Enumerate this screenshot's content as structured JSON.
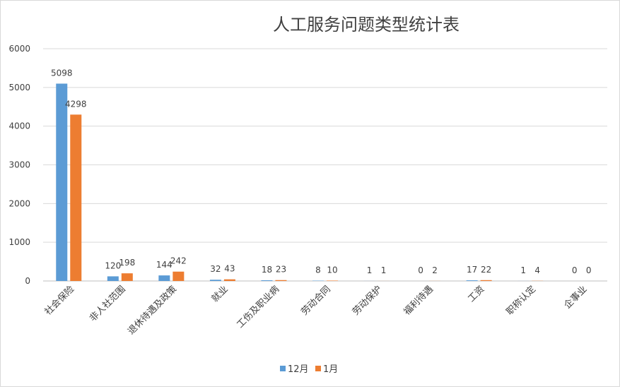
{
  "chart_data": {
    "type": "bar",
    "title": "人工服务问题类型统计表",
    "xlabel": "",
    "ylabel": "",
    "ylim": [
      0,
      6000
    ],
    "yticks": [
      0,
      1000,
      2000,
      3000,
      4000,
      5000,
      6000
    ],
    "grid": true,
    "legend_position": "bottom",
    "categories": [
      "社会保险",
      "非人社范围",
      "退休待遇及政策",
      "就业",
      "工伤及职业病",
      "劳动合同",
      "劳动保护",
      "福利待遇",
      "工资",
      "职称认定",
      "企事业"
    ],
    "series": [
      {
        "name": "12月",
        "color": "#5b9bd5",
        "values": [
          5098,
          120,
          144,
          32,
          18,
          8,
          1,
          0,
          17,
          1,
          0
        ]
      },
      {
        "name": "1月",
        "color": "#ed7d31",
        "values": [
          4298,
          198,
          242,
          43,
          23,
          10,
          1,
          2,
          22,
          4,
          0
        ]
      }
    ]
  }
}
